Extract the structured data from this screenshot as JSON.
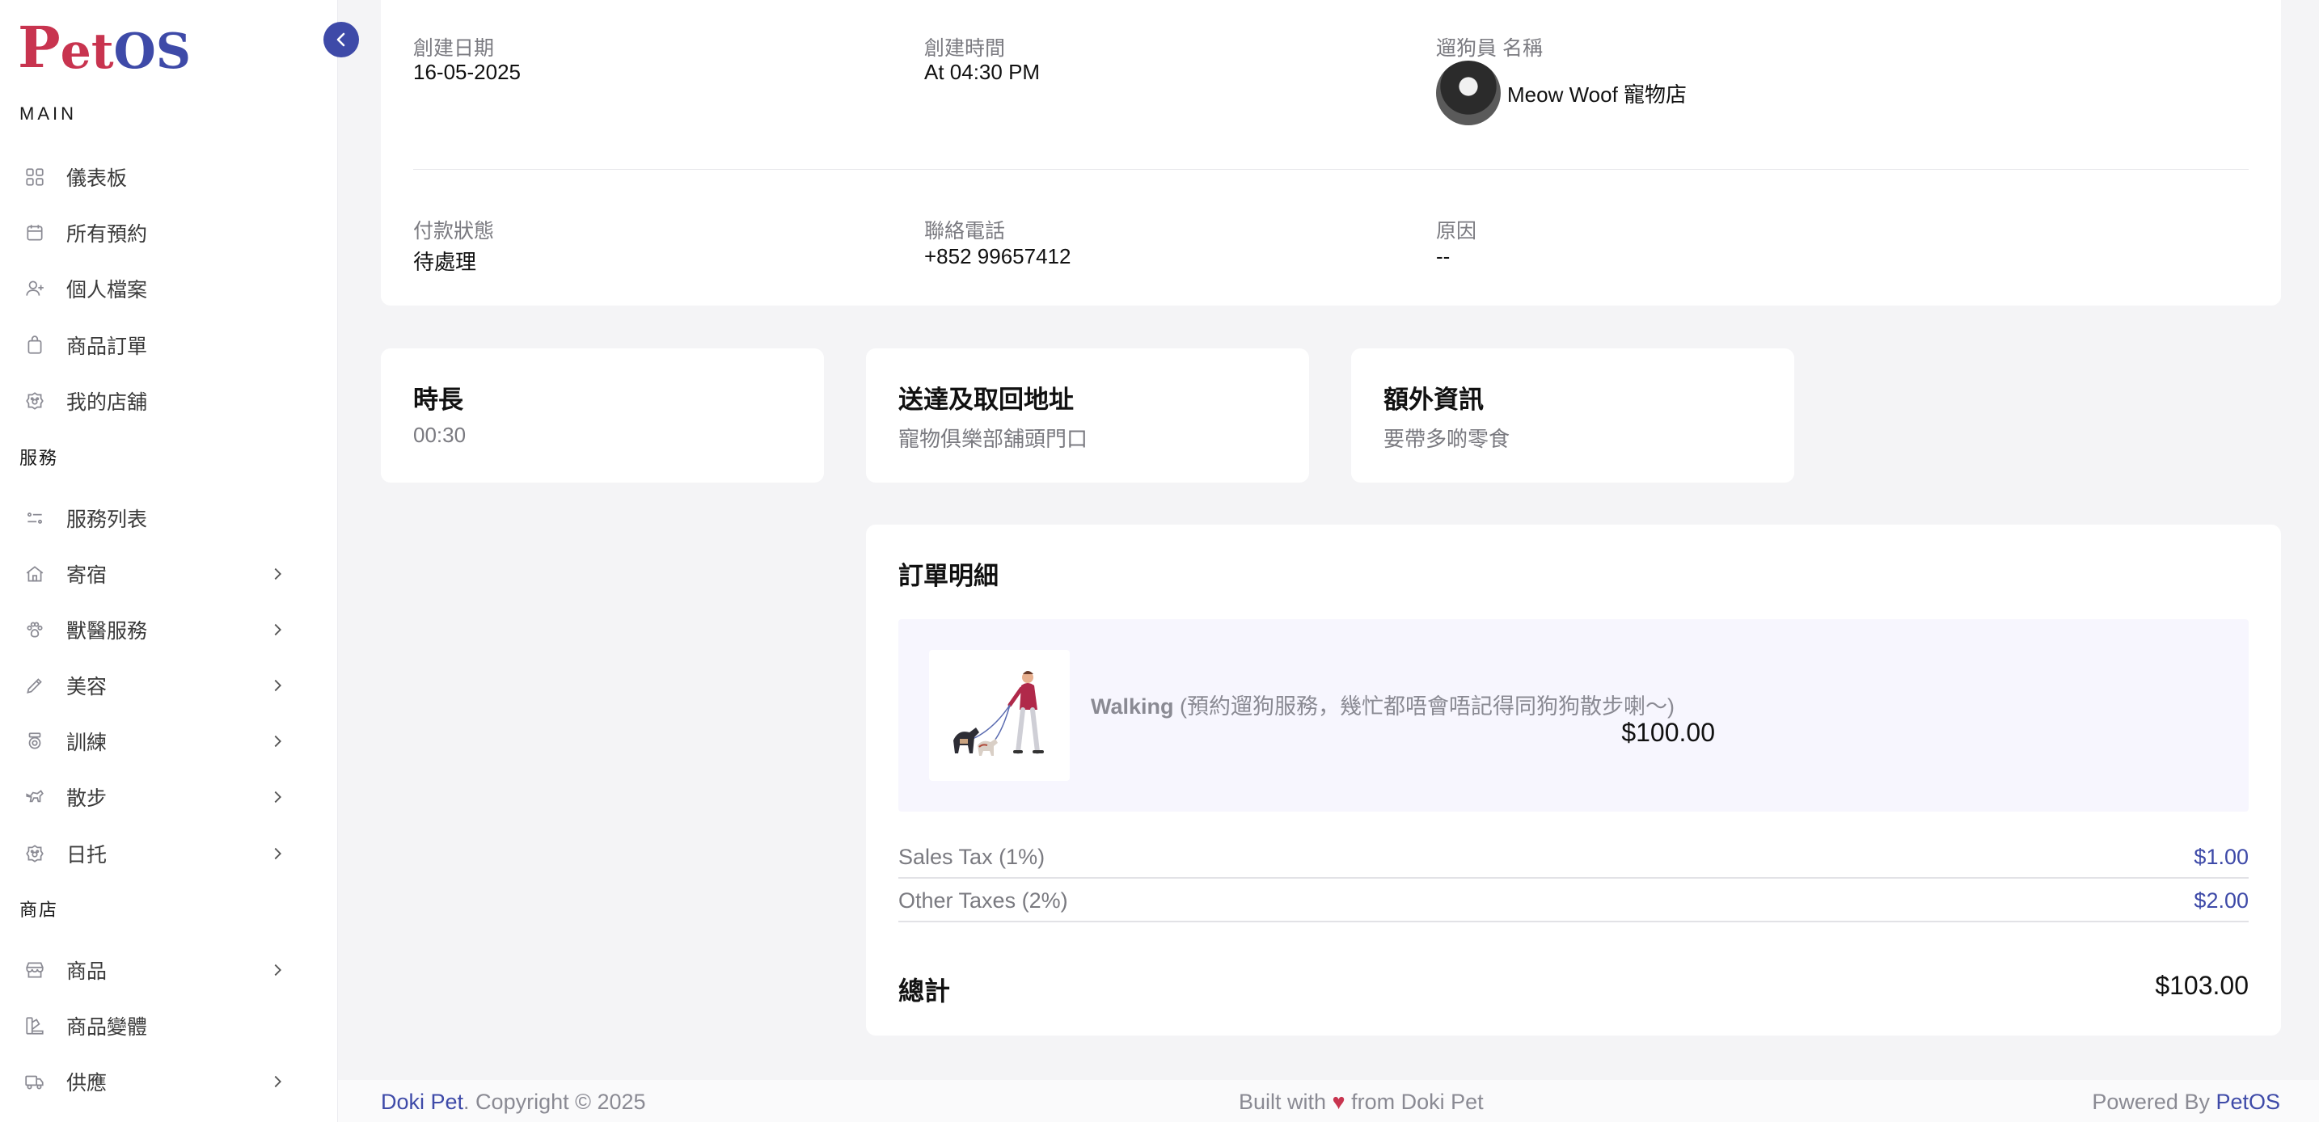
{
  "app": {
    "logo_pet": "P",
    "logo_et": "et",
    "logo_os": "OS"
  },
  "sidebar": {
    "section_main": "MAIN",
    "section_services": "服務",
    "section_shop": "商店",
    "main_items": [
      {
        "label": "儀表板",
        "icon": "grid-icon"
      },
      {
        "label": "所有預約",
        "icon": "calendar-icon"
      },
      {
        "label": "個人檔案",
        "icon": "user-plus-icon"
      },
      {
        "label": "商品訂單",
        "icon": "shopping-bag-icon"
      },
      {
        "label": "我的店舖",
        "icon": "paw-store-icon"
      }
    ],
    "service_items": [
      {
        "label": "服務列表",
        "icon": "list-icon"
      },
      {
        "label": "寄宿",
        "icon": "home-icon"
      },
      {
        "label": "獸醫服務",
        "icon": "paw-icon"
      },
      {
        "label": "美容",
        "icon": "scissors-icon"
      },
      {
        "label": "訓練",
        "icon": "medal-icon"
      },
      {
        "label": "散步",
        "icon": "dog-walk-icon"
      },
      {
        "label": "日托",
        "icon": "paw-store-icon"
      }
    ],
    "shop_items": [
      {
        "label": "商品",
        "icon": "store-icon"
      },
      {
        "label": "商品變體",
        "icon": "variant-icon"
      },
      {
        "label": "供應",
        "icon": "truck-icon"
      }
    ]
  },
  "booking": {
    "created_date_label": "創建日期",
    "created_date": "16-05-2025",
    "created_time_label": "創建時間",
    "created_time": "At 04:30 PM",
    "walker_label": "遛狗員 名稱",
    "walker_name": "Meow Woof 寵物店",
    "payment_status_label": "付款狀態",
    "payment_status": "待處理",
    "phone_label": "聯絡電話",
    "phone": "+852 99657412",
    "reason_label": "原因",
    "reason": "--"
  },
  "cards": {
    "duration_title": "時長",
    "duration_value": "00:30",
    "address_title": "送達及取回地址",
    "address_value": "寵物俱樂部舖頭門口",
    "extra_title": "額外資訊",
    "extra_value": "要帶多啲零食"
  },
  "order": {
    "title": "訂單明細",
    "item_name": "Walking",
    "item_desc": " (預約遛狗服務，幾忙都唔會唔記得同狗狗散步喇～)",
    "item_price": "$100.00",
    "sales_tax_label": "Sales Tax (1%)",
    "sales_tax_value": "$1.00",
    "other_tax_label": "Other Taxes (2%)",
    "other_tax_value": "$2.00",
    "total_label": "總計",
    "total_value": "$103.00"
  },
  "footer": {
    "brand": "Doki Pet",
    "copyright": ". Copyright © 2025",
    "built_prefix": "Built with ",
    "built_suffix": " from Doki Pet",
    "powered_prefix": "Powered By ",
    "powered_brand": "PetOS"
  },
  "colors": {
    "accent": "#3e4aa8",
    "brand_red": "#c8344f"
  }
}
